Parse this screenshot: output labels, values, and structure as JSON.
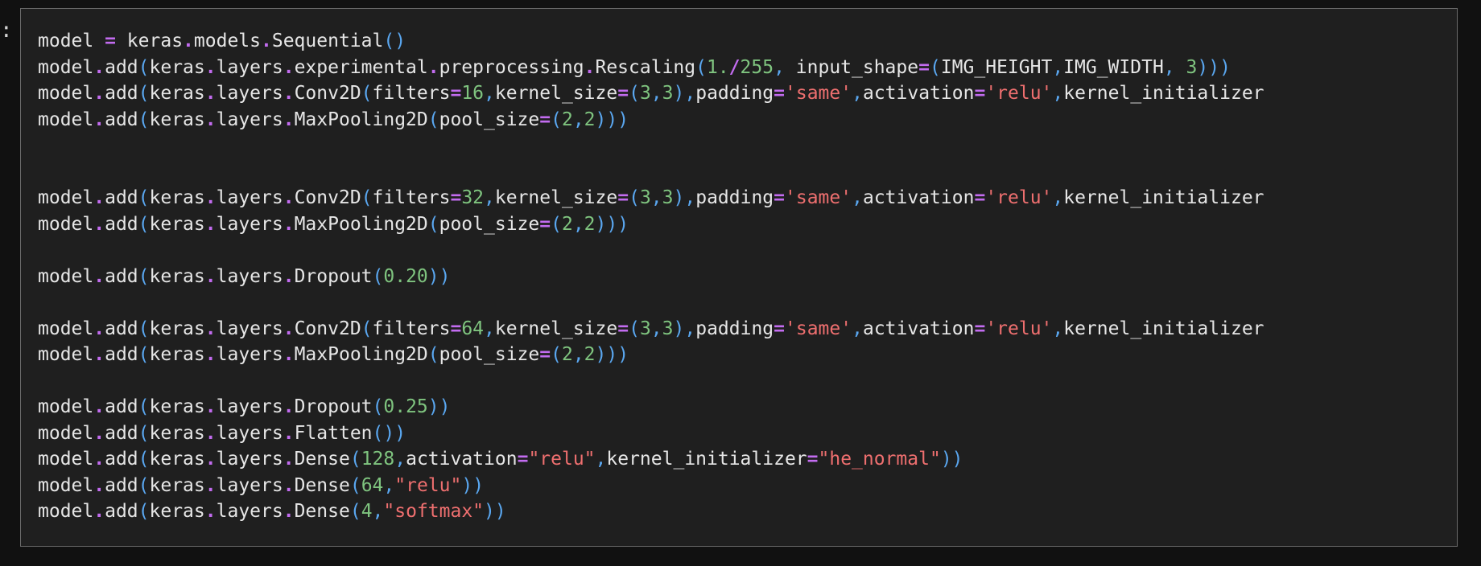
{
  "prompt_marker": ":",
  "colors": {
    "background": "#111111",
    "cell_background": "#1f1f1f",
    "cell_border": "#6a6a6a",
    "plain": "#e6e6e6",
    "operator": "#c36cf0",
    "paren": "#5aa7f0",
    "number": "#7fc47f",
    "string": "#ee6f6f"
  },
  "code_lines": [
    [
      [
        "plain",
        "model "
      ],
      [
        "op",
        "="
      ],
      [
        "plain",
        " keras"
      ],
      [
        "op",
        "."
      ],
      [
        "plain",
        "models"
      ],
      [
        "op",
        "."
      ],
      [
        "plain",
        "Sequential"
      ],
      [
        "paren",
        "()"
      ]
    ],
    [
      [
        "plain",
        "model"
      ],
      [
        "op",
        "."
      ],
      [
        "plain",
        "add"
      ],
      [
        "paren",
        "("
      ],
      [
        "plain",
        "keras"
      ],
      [
        "op",
        "."
      ],
      [
        "plain",
        "layers"
      ],
      [
        "op",
        "."
      ],
      [
        "plain",
        "experimental"
      ],
      [
        "op",
        "."
      ],
      [
        "plain",
        "preprocessing"
      ],
      [
        "op",
        "."
      ],
      [
        "plain",
        "Rescaling"
      ],
      [
        "paren",
        "("
      ],
      [
        "num",
        "1."
      ],
      [
        "op",
        "/"
      ],
      [
        "num",
        "255"
      ],
      [
        "paren",
        ","
      ],
      [
        "plain",
        " input_shape"
      ],
      [
        "op",
        "="
      ],
      [
        "paren",
        "("
      ],
      [
        "plain",
        "IMG_HEIGHT"
      ],
      [
        "paren",
        ","
      ],
      [
        "plain",
        "IMG_WIDTH"
      ],
      [
        "paren",
        ","
      ],
      [
        "plain",
        " "
      ],
      [
        "num",
        "3"
      ],
      [
        "paren",
        ")))"
      ]
    ],
    [
      [
        "plain",
        "model"
      ],
      [
        "op",
        "."
      ],
      [
        "plain",
        "add"
      ],
      [
        "paren",
        "("
      ],
      [
        "plain",
        "keras"
      ],
      [
        "op",
        "."
      ],
      [
        "plain",
        "layers"
      ],
      [
        "op",
        "."
      ],
      [
        "plain",
        "Conv2D"
      ],
      [
        "paren",
        "("
      ],
      [
        "plain",
        "filters"
      ],
      [
        "op",
        "="
      ],
      [
        "num",
        "16"
      ],
      [
        "paren",
        ","
      ],
      [
        "plain",
        "kernel_size"
      ],
      [
        "op",
        "="
      ],
      [
        "paren",
        "("
      ],
      [
        "num",
        "3"
      ],
      [
        "paren",
        ","
      ],
      [
        "num",
        "3"
      ],
      [
        "paren",
        "),"
      ],
      [
        "plain",
        "padding"
      ],
      [
        "op",
        "="
      ],
      [
        "str",
        "'same'"
      ],
      [
        "paren",
        ","
      ],
      [
        "plain",
        "activation"
      ],
      [
        "op",
        "="
      ],
      [
        "str",
        "'relu'"
      ],
      [
        "paren",
        ","
      ],
      [
        "plain",
        "kernel_initializer"
      ]
    ],
    [
      [
        "plain",
        "model"
      ],
      [
        "op",
        "."
      ],
      [
        "plain",
        "add"
      ],
      [
        "paren",
        "("
      ],
      [
        "plain",
        "keras"
      ],
      [
        "op",
        "."
      ],
      [
        "plain",
        "layers"
      ],
      [
        "op",
        "."
      ],
      [
        "plain",
        "MaxPooling2D"
      ],
      [
        "paren",
        "("
      ],
      [
        "plain",
        "pool_size"
      ],
      [
        "op",
        "="
      ],
      [
        "paren",
        "("
      ],
      [
        "num",
        "2"
      ],
      [
        "paren",
        ","
      ],
      [
        "num",
        "2"
      ],
      [
        "paren",
        ")))"
      ]
    ],
    [],
    [],
    [
      [
        "plain",
        "model"
      ],
      [
        "op",
        "."
      ],
      [
        "plain",
        "add"
      ],
      [
        "paren",
        "("
      ],
      [
        "plain",
        "keras"
      ],
      [
        "op",
        "."
      ],
      [
        "plain",
        "layers"
      ],
      [
        "op",
        "."
      ],
      [
        "plain",
        "Conv2D"
      ],
      [
        "paren",
        "("
      ],
      [
        "plain",
        "filters"
      ],
      [
        "op",
        "="
      ],
      [
        "num",
        "32"
      ],
      [
        "paren",
        ","
      ],
      [
        "plain",
        "kernel_size"
      ],
      [
        "op",
        "="
      ],
      [
        "paren",
        "("
      ],
      [
        "num",
        "3"
      ],
      [
        "paren",
        ","
      ],
      [
        "num",
        "3"
      ],
      [
        "paren",
        "),"
      ],
      [
        "plain",
        "padding"
      ],
      [
        "op",
        "="
      ],
      [
        "str",
        "'same'"
      ],
      [
        "paren",
        ","
      ],
      [
        "plain",
        "activation"
      ],
      [
        "op",
        "="
      ],
      [
        "str",
        "'relu'"
      ],
      [
        "paren",
        ","
      ],
      [
        "plain",
        "kernel_initializer"
      ]
    ],
    [
      [
        "plain",
        "model"
      ],
      [
        "op",
        "."
      ],
      [
        "plain",
        "add"
      ],
      [
        "paren",
        "("
      ],
      [
        "plain",
        "keras"
      ],
      [
        "op",
        "."
      ],
      [
        "plain",
        "layers"
      ],
      [
        "op",
        "."
      ],
      [
        "plain",
        "MaxPooling2D"
      ],
      [
        "paren",
        "("
      ],
      [
        "plain",
        "pool_size"
      ],
      [
        "op",
        "="
      ],
      [
        "paren",
        "("
      ],
      [
        "num",
        "2"
      ],
      [
        "paren",
        ","
      ],
      [
        "num",
        "2"
      ],
      [
        "paren",
        ")))"
      ]
    ],
    [],
    [
      [
        "plain",
        "model"
      ],
      [
        "op",
        "."
      ],
      [
        "plain",
        "add"
      ],
      [
        "paren",
        "("
      ],
      [
        "plain",
        "keras"
      ],
      [
        "op",
        "."
      ],
      [
        "plain",
        "layers"
      ],
      [
        "op",
        "."
      ],
      [
        "plain",
        "Dropout"
      ],
      [
        "paren",
        "("
      ],
      [
        "num",
        "0.20"
      ],
      [
        "paren",
        "))"
      ]
    ],
    [],
    [
      [
        "plain",
        "model"
      ],
      [
        "op",
        "."
      ],
      [
        "plain",
        "add"
      ],
      [
        "paren",
        "("
      ],
      [
        "plain",
        "keras"
      ],
      [
        "op",
        "."
      ],
      [
        "plain",
        "layers"
      ],
      [
        "op",
        "."
      ],
      [
        "plain",
        "Conv2D"
      ],
      [
        "paren",
        "("
      ],
      [
        "plain",
        "filters"
      ],
      [
        "op",
        "="
      ],
      [
        "num",
        "64"
      ],
      [
        "paren",
        ","
      ],
      [
        "plain",
        "kernel_size"
      ],
      [
        "op",
        "="
      ],
      [
        "paren",
        "("
      ],
      [
        "num",
        "3"
      ],
      [
        "paren",
        ","
      ],
      [
        "num",
        "3"
      ],
      [
        "paren",
        "),"
      ],
      [
        "plain",
        "padding"
      ],
      [
        "op",
        "="
      ],
      [
        "str",
        "'same'"
      ],
      [
        "paren",
        ","
      ],
      [
        "plain",
        "activation"
      ],
      [
        "op",
        "="
      ],
      [
        "str",
        "'relu'"
      ],
      [
        "paren",
        ","
      ],
      [
        "plain",
        "kernel_initializer"
      ]
    ],
    [
      [
        "plain",
        "model"
      ],
      [
        "op",
        "."
      ],
      [
        "plain",
        "add"
      ],
      [
        "paren",
        "("
      ],
      [
        "plain",
        "keras"
      ],
      [
        "op",
        "."
      ],
      [
        "plain",
        "layers"
      ],
      [
        "op",
        "."
      ],
      [
        "plain",
        "MaxPooling2D"
      ],
      [
        "paren",
        "("
      ],
      [
        "plain",
        "pool_size"
      ],
      [
        "op",
        "="
      ],
      [
        "paren",
        "("
      ],
      [
        "num",
        "2"
      ],
      [
        "paren",
        ","
      ],
      [
        "num",
        "2"
      ],
      [
        "paren",
        ")))"
      ]
    ],
    [],
    [
      [
        "plain",
        "model"
      ],
      [
        "op",
        "."
      ],
      [
        "plain",
        "add"
      ],
      [
        "paren",
        "("
      ],
      [
        "plain",
        "keras"
      ],
      [
        "op",
        "."
      ],
      [
        "plain",
        "layers"
      ],
      [
        "op",
        "."
      ],
      [
        "plain",
        "Dropout"
      ],
      [
        "paren",
        "("
      ],
      [
        "num",
        "0.25"
      ],
      [
        "paren",
        "))"
      ]
    ],
    [
      [
        "plain",
        "model"
      ],
      [
        "op",
        "."
      ],
      [
        "plain",
        "add"
      ],
      [
        "paren",
        "("
      ],
      [
        "plain",
        "keras"
      ],
      [
        "op",
        "."
      ],
      [
        "plain",
        "layers"
      ],
      [
        "op",
        "."
      ],
      [
        "plain",
        "Flatten"
      ],
      [
        "paren",
        "())"
      ]
    ],
    [
      [
        "plain",
        "model"
      ],
      [
        "op",
        "."
      ],
      [
        "plain",
        "add"
      ],
      [
        "paren",
        "("
      ],
      [
        "plain",
        "keras"
      ],
      [
        "op",
        "."
      ],
      [
        "plain",
        "layers"
      ],
      [
        "op",
        "."
      ],
      [
        "plain",
        "Dense"
      ],
      [
        "paren",
        "("
      ],
      [
        "num",
        "128"
      ],
      [
        "paren",
        ","
      ],
      [
        "plain",
        "activation"
      ],
      [
        "op",
        "="
      ],
      [
        "str",
        "\"relu\""
      ],
      [
        "paren",
        ","
      ],
      [
        "plain",
        "kernel_initializer"
      ],
      [
        "op",
        "="
      ],
      [
        "str",
        "\"he_normal\""
      ],
      [
        "paren",
        "))"
      ]
    ],
    [
      [
        "plain",
        "model"
      ],
      [
        "op",
        "."
      ],
      [
        "plain",
        "add"
      ],
      [
        "paren",
        "("
      ],
      [
        "plain",
        "keras"
      ],
      [
        "op",
        "."
      ],
      [
        "plain",
        "layers"
      ],
      [
        "op",
        "."
      ],
      [
        "plain",
        "Dense"
      ],
      [
        "paren",
        "("
      ],
      [
        "num",
        "64"
      ],
      [
        "paren",
        ","
      ],
      [
        "str",
        "\"relu\""
      ],
      [
        "paren",
        "))"
      ]
    ],
    [
      [
        "plain",
        "model"
      ],
      [
        "op",
        "."
      ],
      [
        "plain",
        "add"
      ],
      [
        "paren",
        "("
      ],
      [
        "plain",
        "keras"
      ],
      [
        "op",
        "."
      ],
      [
        "plain",
        "layers"
      ],
      [
        "op",
        "."
      ],
      [
        "plain",
        "Dense"
      ],
      [
        "paren",
        "("
      ],
      [
        "num",
        "4"
      ],
      [
        "paren",
        ","
      ],
      [
        "str",
        "\"softmax\""
      ],
      [
        "paren",
        "))"
      ]
    ]
  ]
}
